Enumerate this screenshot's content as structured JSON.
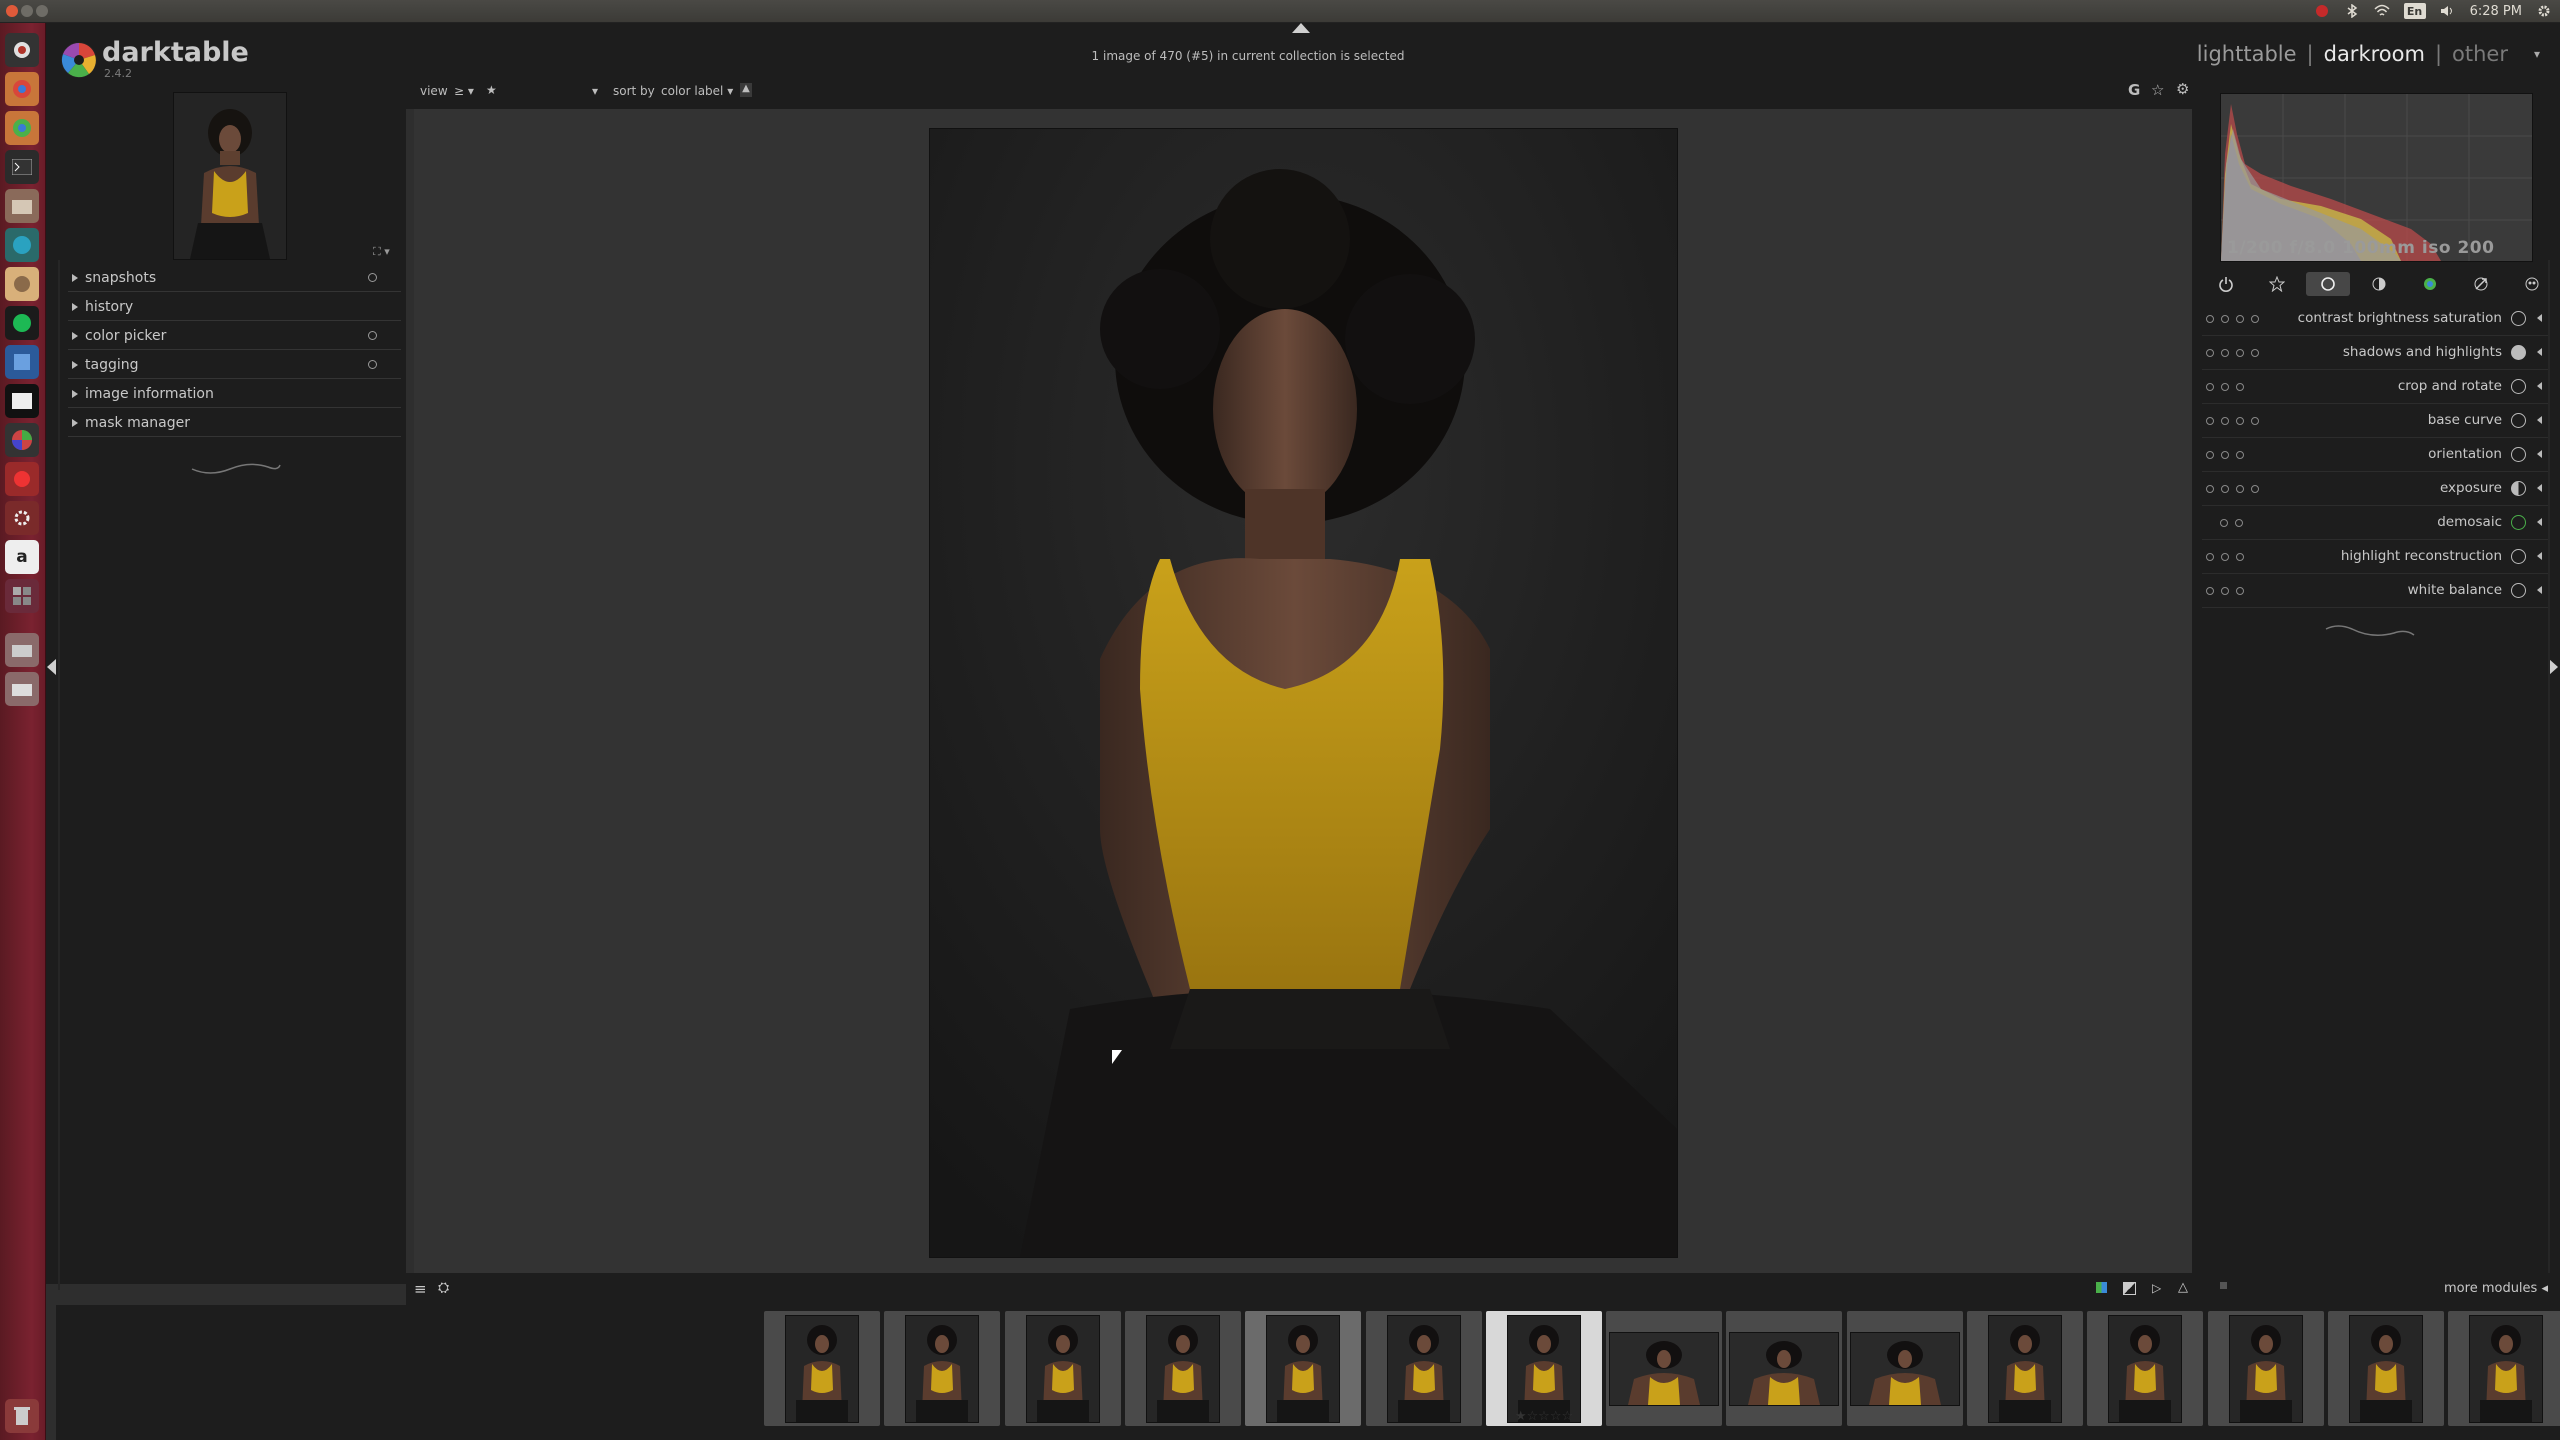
{
  "system": {
    "clock": "6:28 PM",
    "keyboard_layout": "En"
  },
  "app": {
    "name": "darktable",
    "version": "2.4.2",
    "selection_status": "1 image of 470 (#5) in current collection is selected"
  },
  "views": {
    "lighttable": "lighttable",
    "darkroom": "darkroom",
    "other": "other",
    "separator": "|",
    "active": "darkroom"
  },
  "toolbar": {
    "view_label": "view",
    "rating_comparator": "≥",
    "rating_value": "★",
    "sort_label": "sort by",
    "sort_value": "color label"
  },
  "left_modules": [
    {
      "label": "snapshots",
      "has_reset": true
    },
    {
      "label": "history",
      "has_reset": false
    },
    {
      "label": "color picker",
      "has_reset": true
    },
    {
      "label": "tagging",
      "has_reset": true
    },
    {
      "label": "image information",
      "has_reset": false
    },
    {
      "label": "mask manager",
      "has_reset": false
    }
  ],
  "histogram": {
    "exif_info": "1/200 f/8.0 100mm iso 200"
  },
  "module_groups": [
    "power-icon",
    "star-icon",
    "circle-icon",
    "half-circle-icon",
    "color-icon",
    "correct-icon",
    "effect-icon"
  ],
  "right_modules": [
    {
      "label": "contrast brightness saturation",
      "icon": "contrast-icon"
    },
    {
      "label": "shadows and highlights",
      "icon": "shadows-icon"
    },
    {
      "label": "crop and rotate",
      "icon": "crop-icon"
    },
    {
      "label": "base curve",
      "icon": "curve-icon"
    },
    {
      "label": "orientation",
      "icon": "orientation-icon"
    },
    {
      "label": "exposure",
      "icon": "exposure-icon"
    },
    {
      "label": "demosaic",
      "icon": "demosaic-icon"
    },
    {
      "label": "highlight reconstruction",
      "icon": "highlight-icon"
    },
    {
      "label": "white balance",
      "icon": "white-balance-icon"
    }
  ],
  "more_modules_label": "more modules",
  "filmstrip": {
    "selected_rating": "★☆☆☆☆",
    "thumbs": [
      {
        "style": "portrait"
      },
      {
        "style": "portrait"
      },
      {
        "style": "portrait"
      },
      {
        "style": "portrait"
      },
      {
        "style": "portrait",
        "state": "active"
      },
      {
        "style": "portrait"
      },
      {
        "style": "portrait",
        "state": "selected"
      },
      {
        "style": "landscape"
      },
      {
        "style": "landscape"
      },
      {
        "style": "landscape"
      },
      {
        "style": "portrait"
      },
      {
        "style": "portrait"
      },
      {
        "style": "portrait"
      },
      {
        "style": "portrait"
      },
      {
        "style": "portrait"
      }
    ]
  },
  "colors": {
    "panel_bg": "#1d1d1d",
    "center_bg": "#333333",
    "launcher": "#7a2230",
    "shirt_yellow": "#c9a11a",
    "skin": "#6b4a3a"
  }
}
